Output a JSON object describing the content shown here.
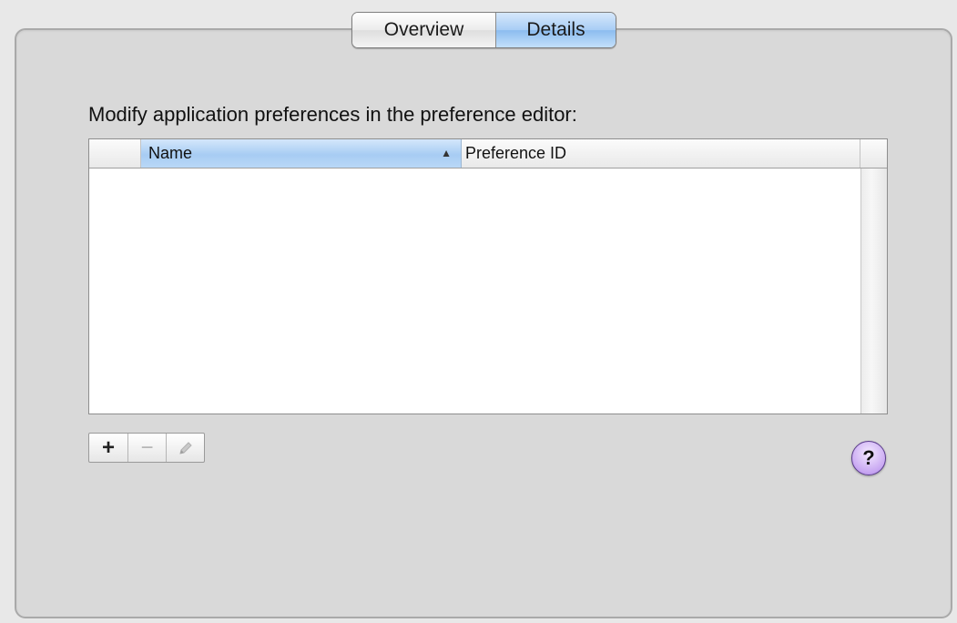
{
  "tabs": {
    "overview_label": "Overview",
    "details_label": "Details",
    "selected": "Details"
  },
  "instruction": "Modify application preferences in the preference editor:",
  "table": {
    "columns": [
      {
        "label": "",
        "key": "blank"
      },
      {
        "label": "Name",
        "key": "name",
        "sorted": "ascending"
      },
      {
        "label": "Preference ID",
        "key": "preference_id"
      }
    ],
    "sort_indicator": "▲",
    "rows": []
  },
  "buttons": {
    "add_label": "+",
    "remove_label": "−",
    "edit_icon": "pencil-icon"
  },
  "help": {
    "label": "?"
  },
  "colors": {
    "selected_tab": "#a8cdf5",
    "sorted_header": "#a7ccf3",
    "help_button": "#c8a7f2"
  }
}
